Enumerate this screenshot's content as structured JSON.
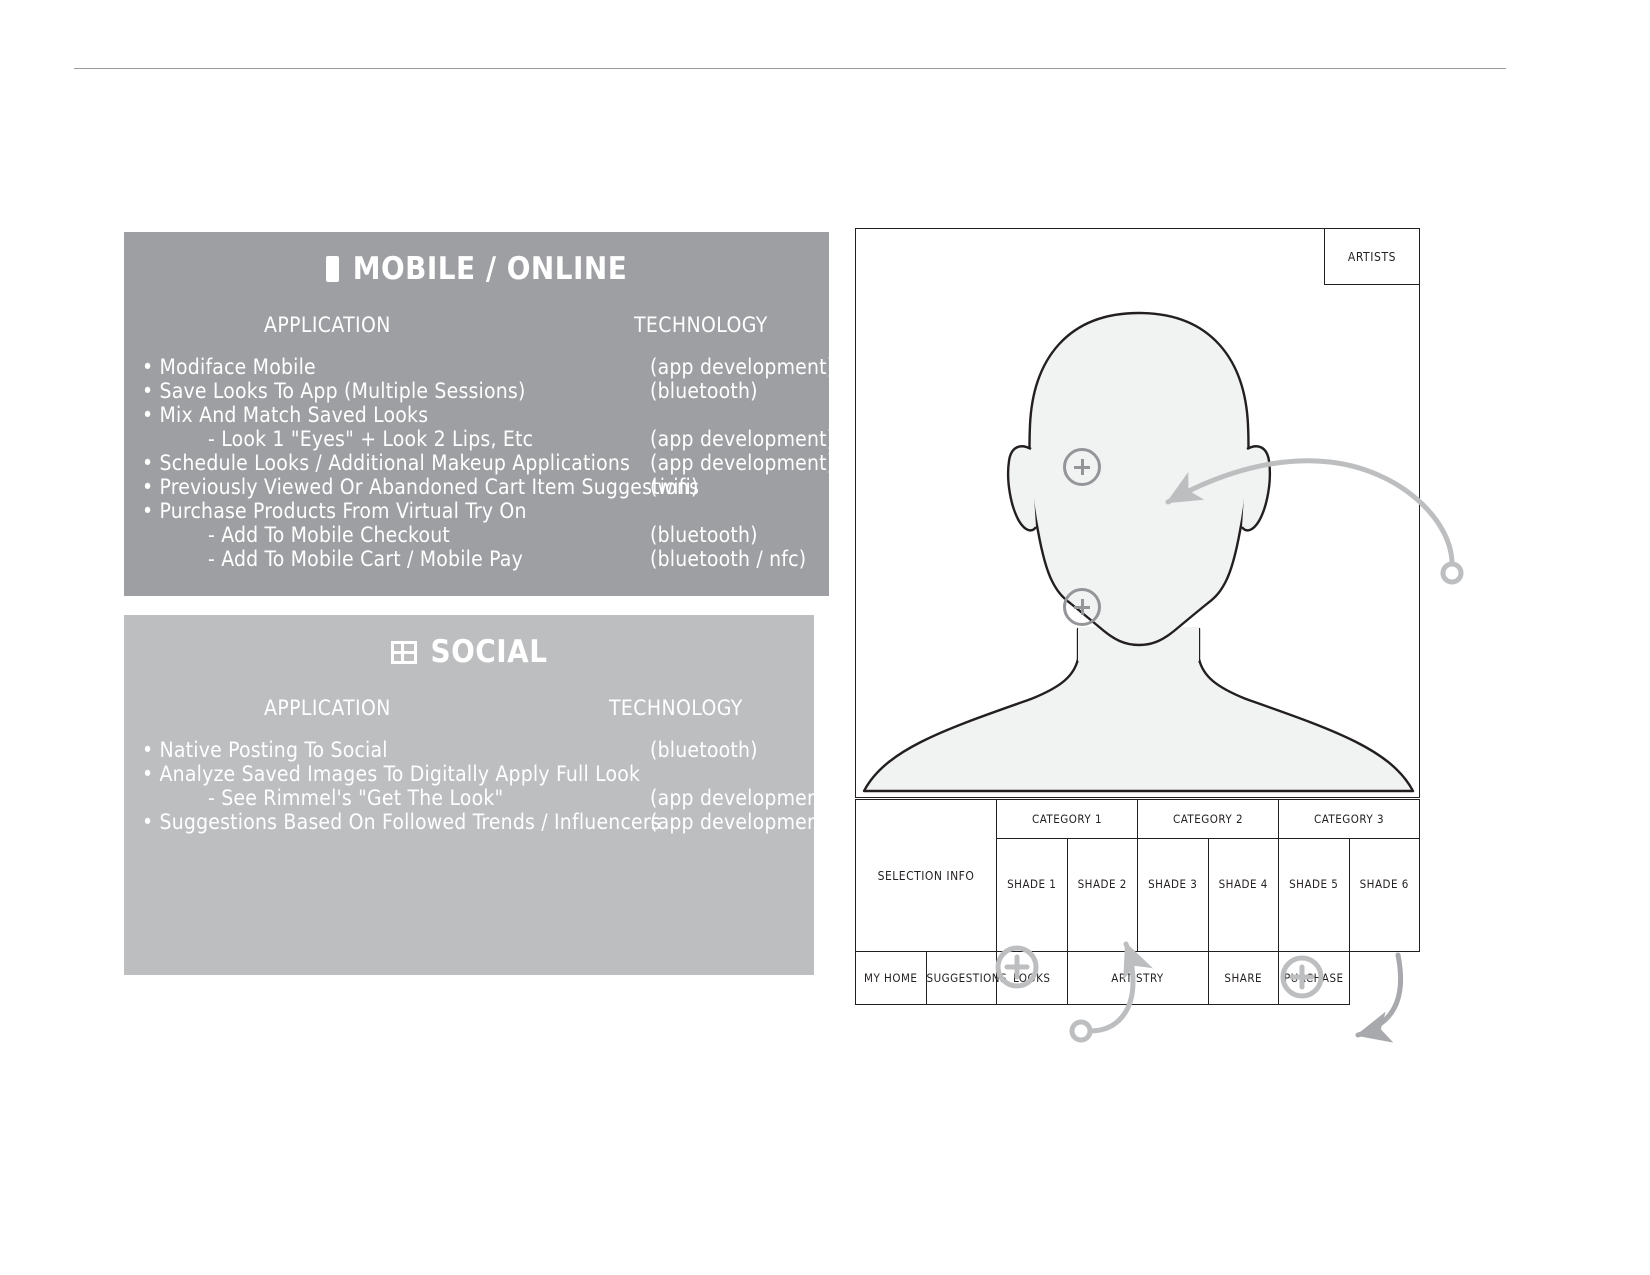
{
  "panels": [
    {
      "id": "mobile-online",
      "title": "MOBILE / ONLINE",
      "icon": "mobile-phone-icon",
      "bg": "#9d9fa2",
      "columns": {
        "application": "APPLICATION",
        "technology": "TECHNOLOGY"
      },
      "rows": [
        {
          "app": "• Modiface Mobile",
          "tech": "(app development)",
          "indent": false
        },
        {
          "app": "• Save Looks To App (Multiple Sessions)",
          "tech": "(bluetooth)",
          "indent": false
        },
        {
          "app": "• Mix And Match Saved Looks",
          "tech": "",
          "indent": false
        },
        {
          "app": "- Look 1 \"Eyes\" + Look 2 Lips, Etc",
          "tech": "(app development)",
          "indent": true
        },
        {
          "app": "• Schedule Looks / Additional Makeup Applications",
          "tech": "(app development)",
          "indent": false
        },
        {
          "app": "• Previously Viewed Or Abandoned Cart Item Suggestions",
          "tech": "(wifi)",
          "indent": false
        },
        {
          "app": "• Purchase Products From Virtual Try On",
          "tech": "",
          "indent": false
        },
        {
          "app": "- Add To Mobile Checkout",
          "tech": "(bluetooth)",
          "indent": true
        },
        {
          "app": "- Add To Mobile Cart / Mobile Pay",
          "tech": "(bluetooth / nfc)",
          "indent": true
        }
      ]
    },
    {
      "id": "social",
      "title": "SOCIAL",
      "icon": "social-grid-icon",
      "bg": "#bcbec0",
      "columns": {
        "application": "APPLICATION",
        "technology": "TECHNOLOGY"
      },
      "rows": [
        {
          "app": "• Native Posting To Social",
          "tech": "(bluetooth)",
          "indent": false
        },
        {
          "app": "• Analyze Saved Images To Digitally Apply Full Look",
          "tech": "",
          "indent": false
        },
        {
          "app": "- See Rimmel's \"Get The Look\"",
          "tech": "(app development)",
          "indent": true
        },
        {
          "app": "• Suggestions Based On Followed Trends / Influencers",
          "tech": "(app development)",
          "indent": false
        }
      ]
    }
  ],
  "device": {
    "artists_tab": "ARTISTS",
    "selection_info": "SELECTION INFO",
    "categories": [
      "CATEGORY 1",
      "CATEGORY 2",
      "CATEGORY 3"
    ],
    "shades": [
      "SHADE 1",
      "SHADE 2",
      "SHADE 3",
      "SHADE 4",
      "SHADE 5",
      "SHADE 6"
    ],
    "nav": [
      "MY HOME",
      "SUGGESTIONS",
      "LOOKS",
      "ARTISTRY",
      "SHARE",
      "PURCHASE"
    ],
    "markers": [
      "plus-marker-face",
      "plus-marker-chin",
      "plus-marker-suggestions",
      "plus-marker-share"
    ]
  },
  "colors": {
    "panel_mobile_bg": "#9d9fa2",
    "panel_social_bg": "#bcbec0",
    "outline": "#231f20",
    "marker": "#939598",
    "annotation": "#bcbec0",
    "bust_fill": "#f1f2f2"
  }
}
